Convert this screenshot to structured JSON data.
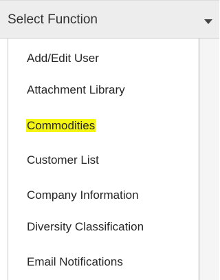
{
  "select": {
    "label": "Select Function",
    "icon": "triangle-down-icon"
  },
  "menu": {
    "items": [
      {
        "label": "Add/Edit User",
        "highlighted": false
      },
      {
        "label": "Attachment Library",
        "highlighted": false
      },
      {
        "label": "Commodities",
        "highlighted": true
      },
      {
        "label": "Customer List",
        "highlighted": false
      },
      {
        "label": "Company Information",
        "highlighted": false
      },
      {
        "label": "Diversity Classification",
        "highlighted": false
      },
      {
        "label": "Email Notifications",
        "highlighted": false
      }
    ]
  },
  "colors": {
    "select_background": "#ededed",
    "highlight": "#f5f513",
    "text": "#262626"
  }
}
